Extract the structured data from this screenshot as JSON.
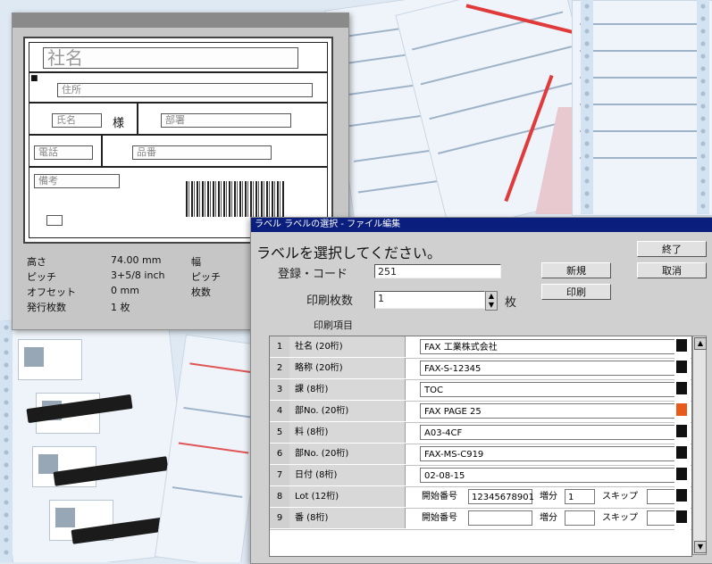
{
  "preview": {
    "company": "社名",
    "address": "住所",
    "name": "氏名",
    "dept": "部署",
    "tel": "電話",
    "code": "品番",
    "note": "備考",
    "info_rows": [
      {
        "label": "高さ",
        "value": "74.00 mm",
        "extra": "幅"
      },
      {
        "label": "ピッチ",
        "value": "3+5/8 inch",
        "extra": "ピッチ"
      },
      {
        "label": "オフセット",
        "value": "0 mm",
        "extra": "枚数"
      },
      {
        "label": "発行枚数",
        "value": "1 枚",
        "extra": ""
      }
    ]
  },
  "select_dialog": {
    "title": "ラベル ラベルの選択 - ファイル編集",
    "prompt": "ラベルを選択してください。",
    "code_label": "登録・コード",
    "code_value": "251",
    "count_label": "印刷枚数",
    "count_value": "1",
    "count_unit": "枚",
    "items_label": "印刷項目",
    "buttons": {
      "ok": "終了",
      "cancel": "取消",
      "new": "新規",
      "print": "印刷"
    },
    "spin_up": "▲",
    "spin_down": "▼",
    "scroll_up": "▲",
    "scroll_down": "▼",
    "rows": [
      {
        "no": "1",
        "name": "社名 (20桁)",
        "value": "FAX 工業株式会社",
        "color": "#111111"
      },
      {
        "no": "2",
        "name": "略称 (20桁)",
        "value": "FAX-S-12345",
        "color": "#111111"
      },
      {
        "no": "3",
        "name": "課 (8桁)",
        "value": "TOC",
        "color": "#111111"
      },
      {
        "no": "4",
        "name": "部No. (20桁)",
        "value": "FAX PAGE 25",
        "color": "#e85a1a"
      },
      {
        "no": "5",
        "name": "料 (8桁)",
        "value": "A03-4CF",
        "color": "#111111"
      },
      {
        "no": "6",
        "name": "部No. (20桁)",
        "value": "FAX-MS-C919",
        "color": "#111111"
      },
      {
        "no": "7",
        "name": "日付 (8桁)",
        "value": "02-08-15",
        "color": "#111111"
      },
      {
        "no": "8",
        "name": "Lot (12桁)",
        "value": "",
        "start_label": "開始番号",
        "start": "12345678901",
        "inc_label": "増分",
        "inc": "1",
        "skip_label": "スキップ",
        "skip": "",
        "color": "#111111"
      },
      {
        "no": "9",
        "name": "番 (8桁)",
        "value": "",
        "start_label": "開始番号",
        "start": "",
        "inc_label": "増分",
        "inc": "",
        "skip_label": "スキップ",
        "skip": "",
        "color": "#111111"
      }
    ]
  }
}
